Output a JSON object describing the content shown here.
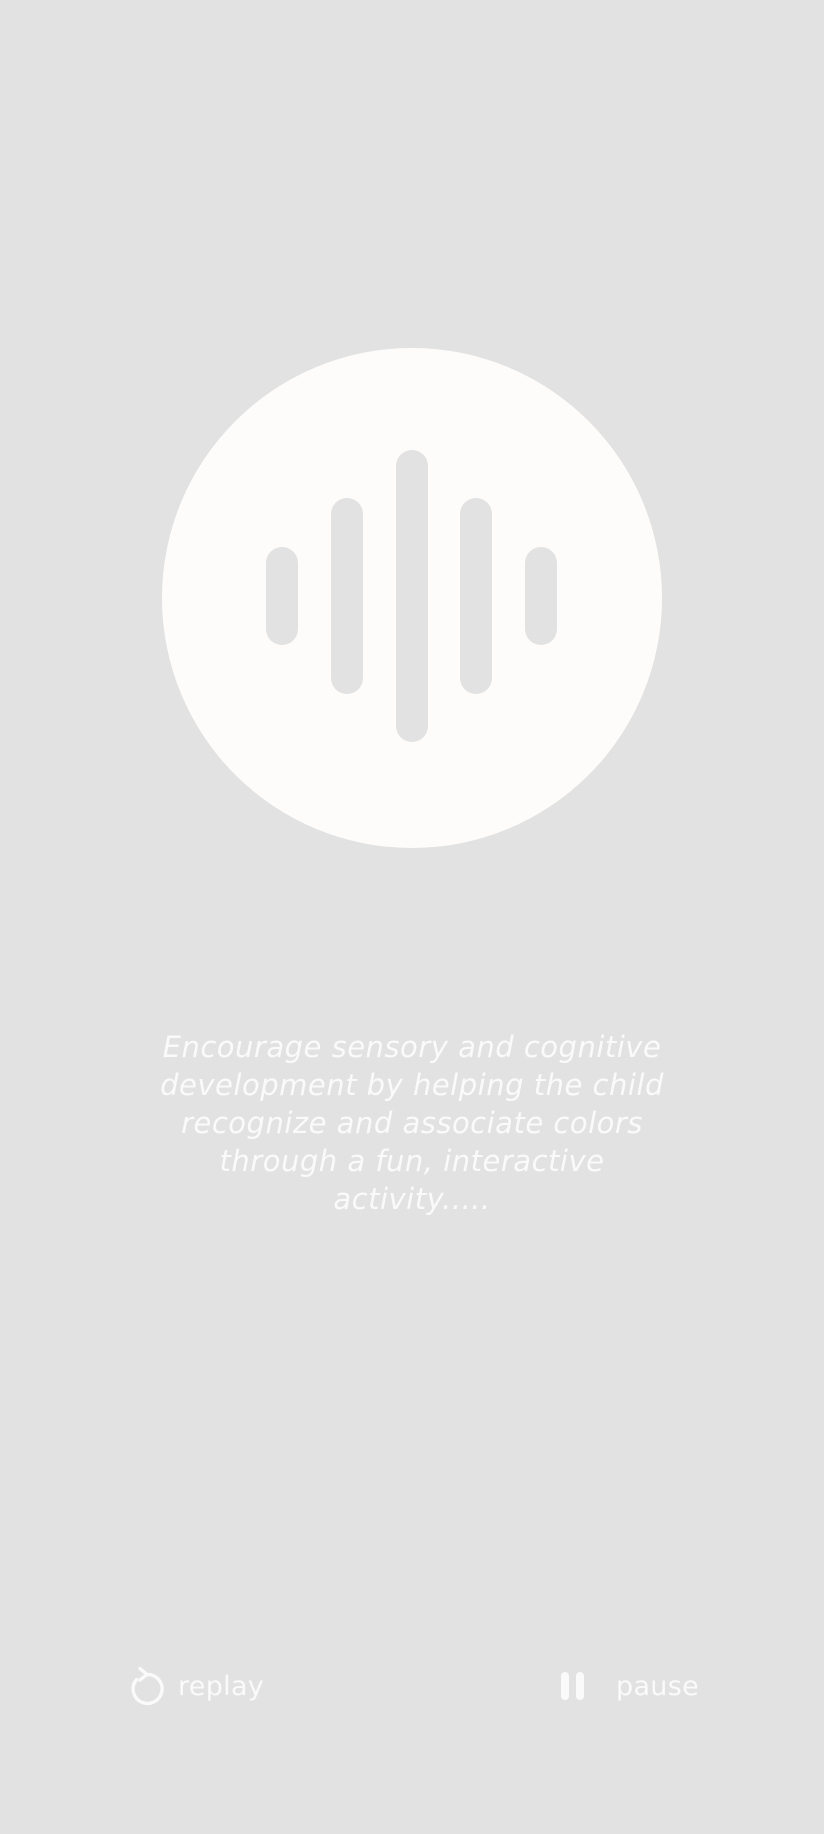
{
  "description": "Encourage sensory and cognitive development by helping the child recognize and associate colors through a fun, interactive activity.....",
  "controls": {
    "replay_label": "replay",
    "pause_label": "pause"
  },
  "icons": {
    "audio": "sound-wave-icon",
    "replay": "replay-icon",
    "pause": "pause-icon"
  },
  "colors": {
    "background": "#e2e2e2",
    "circle": "#fdfcfb",
    "text": "#fafafa"
  }
}
